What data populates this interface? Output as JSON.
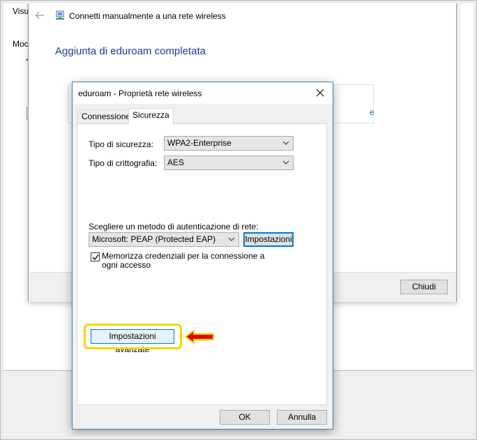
{
  "background": {
    "text_visu": "Visu",
    "text_moc": "Moc"
  },
  "wizard": {
    "title": "Connetti manualmente a una rete wireless",
    "heading": "Aggiunta di eduroam completata",
    "box_link_fragment": "e",
    "close_label": "Chiudi",
    "back_icon": "back-arrow-icon",
    "network_icon": "network-icon"
  },
  "dialog": {
    "title": "eduroam - Proprietà rete wireless",
    "tabs": [
      {
        "label": "Connessione",
        "active": false
      },
      {
        "label": "Sicurezza",
        "active": true
      }
    ],
    "security_type_label": "Tipo di sicurezza:",
    "security_type_value": "WPA2-Enterprise",
    "encryption_type_label": "Tipo di crittografia:",
    "encryption_type_value": "AES",
    "auth_method_label": "Scegliere un metodo di autenticazione di rete:",
    "auth_method_value": "Microsoft: PEAP (Protected EAP)",
    "settings_button": "Impostazioni",
    "remember_credentials_label": "Memorizza credenziali per la connessione a ogni accesso",
    "remember_credentials_checked": true,
    "advanced_settings_button": "Impostazioni avanzate",
    "ok_button": "OK",
    "cancel_button": "Annulla"
  },
  "colors": {
    "highlight_border": "#f6d600",
    "annotation_arrow": "#e30000",
    "accent": "#0078d7",
    "heading": "#1f3a93"
  }
}
